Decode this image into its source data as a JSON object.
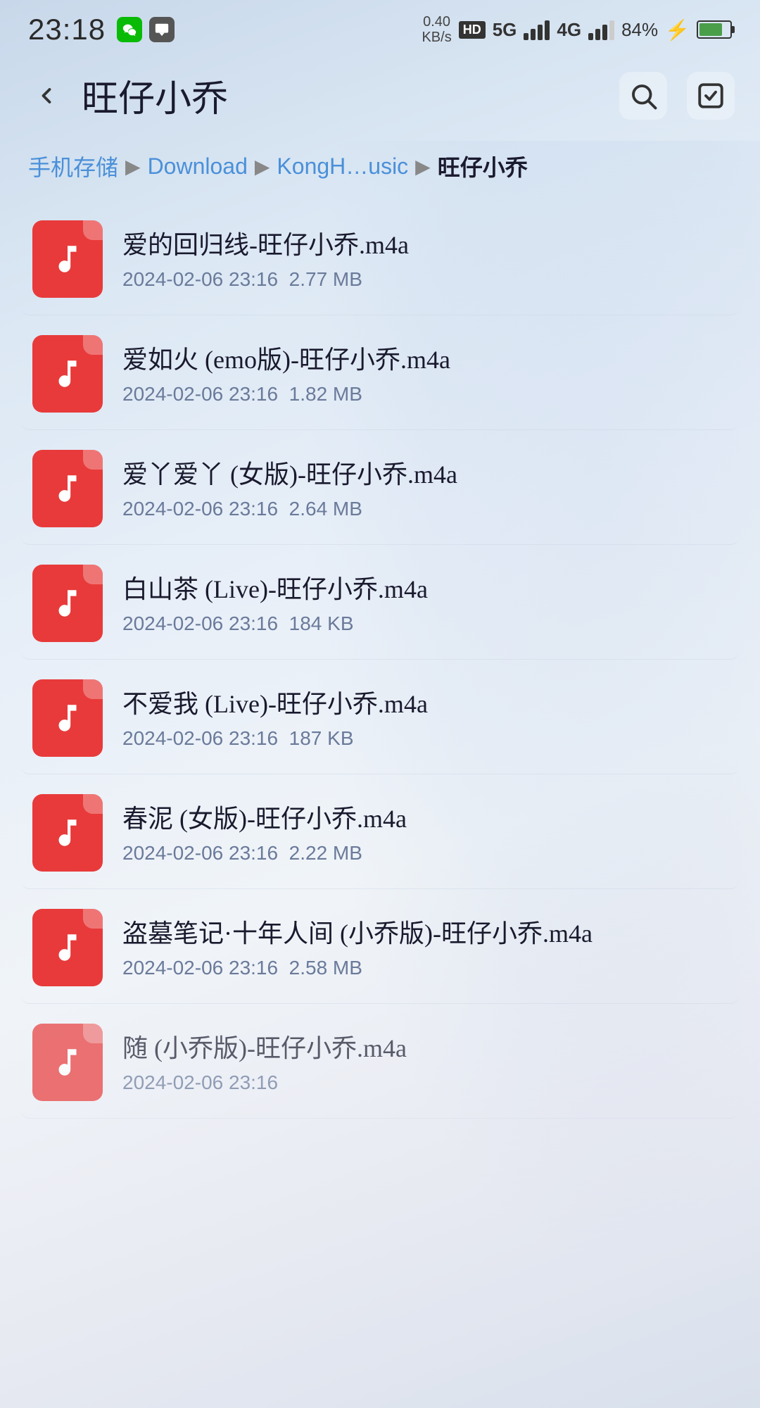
{
  "statusBar": {
    "time": "23:18",
    "speed": "0.40\nKB/s",
    "battery": "84%",
    "network": "5G"
  },
  "nav": {
    "title": "旺仔小乔",
    "backLabel": "返回",
    "searchLabel": "搜索",
    "checkLabel": "选择"
  },
  "breadcrumb": {
    "items": [
      {
        "label": "手机存储",
        "active": false
      },
      {
        "label": "Download",
        "active": false
      },
      {
        "label": "KongH…usic",
        "active": false
      },
      {
        "label": "旺仔小乔",
        "active": true
      }
    ]
  },
  "files": [
    {
      "name": "爱的回归线-旺仔小乔.m4a",
      "date": "2024-02-06 23:16",
      "size": "2.77 MB"
    },
    {
      "name": "爱如火 (emo版)-旺仔小乔.m4a",
      "date": "2024-02-06 23:16",
      "size": "1.82 MB"
    },
    {
      "name": "爱丫爱丫 (女版)-旺仔小乔.m4a",
      "date": "2024-02-06 23:16",
      "size": "2.64 MB"
    },
    {
      "name": "白山茶 (Live)-旺仔小乔.m4a",
      "date": "2024-02-06 23:16",
      "size": "184 KB"
    },
    {
      "name": "不爱我 (Live)-旺仔小乔.m4a",
      "date": "2024-02-06 23:16",
      "size": "187 KB"
    },
    {
      "name": "春泥 (女版)-旺仔小乔.m4a",
      "date": "2024-02-06 23:16",
      "size": "2.22 MB"
    },
    {
      "name": "盗墓笔记·十年人间 (小乔版)-旺仔小乔.m4a",
      "date": "2024-02-06 23:16",
      "size": "2.58 MB"
    },
    {
      "name": "随 (小乔版)-旺仔小乔.m4a",
      "date": "2024-02-06 23:16",
      "size": "..."
    }
  ]
}
